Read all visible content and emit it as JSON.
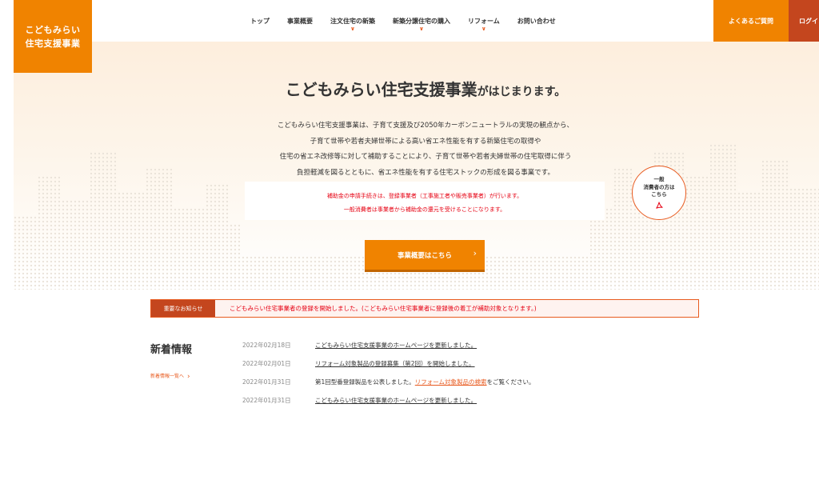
{
  "logo": {
    "line1": "こどもみらい",
    "line2": "住宅支援事業"
  },
  "nav": {
    "items": [
      {
        "label": "トップ",
        "has_dropdown": false
      },
      {
        "label": "事業概要",
        "has_dropdown": false
      },
      {
        "label": "注文住宅の新築",
        "has_dropdown": true
      },
      {
        "label": "新築分譲住宅の購入",
        "has_dropdown": true
      },
      {
        "label": "リフォーム",
        "has_dropdown": true
      },
      {
        "label": "お問い合わせ",
        "has_dropdown": false
      }
    ],
    "dropdown_icon": "chevron-down-icon"
  },
  "header_buttons": {
    "faq": "よくあるご質問",
    "login": "ログイン"
  },
  "hero": {
    "title_main": "こどもみらい住宅支援事業",
    "title_suffix": "がはじまります。",
    "description": [
      "こどもみらい住宅支援事業は、子育て支援及び2050年カーボンニュートラルの実現の観点から、",
      "子育て世帯や若者夫婦世帯による高い省エネ性能を有する新築住宅の取得や",
      "住宅の省エネ改修等に対して補助することにより、子育て世帯や若者夫婦世帯の住宅取得に伴う",
      "負担軽減を図るとともに、省エネ性能を有する住宅ストックの形成を図る事業です。"
    ],
    "notice": [
      "補助金の申請手続きは、登録事業者（工事施工者や販売事業者）が行います。",
      "一般消費者は事業者から補助金の還元を受けることになります。"
    ],
    "consumer_badge": {
      "line1": "一般",
      "line2": "消費者の方は",
      "line3": "こちら",
      "icon": "pdf-icon"
    },
    "overview_button": "事業概要はこちら"
  },
  "alert": {
    "label": "重要なお知らせ",
    "text": "こどもみらい住宅事業者の登録を開始しました。(こどもみらい住宅事業者に登録後の着工が補助対象となります。)"
  },
  "news": {
    "heading": "新着情報",
    "view_all": "新着情報一覧へ",
    "items": [
      {
        "date": "2022年02月18日",
        "text": "こどもみらい住宅支援事業のホームページを更新しました。",
        "link_text": ""
      },
      {
        "date": "2022年02月01日",
        "text": "リフォーム対象製品の登録募集（第2回）を開始しました。",
        "link_text": ""
      },
      {
        "date": "2022年01月31日",
        "text": "第1回型番登録製品を公表しました。",
        "link_text": "リフォーム対象製品の検索",
        "suffix": "をご覧ください。"
      },
      {
        "date": "2022年01月31日",
        "text": "こどもみらい住宅支援事業のホームページを更新しました。",
        "link_text": ""
      }
    ]
  },
  "colors": {
    "brand_orange": "#f08300",
    "brand_red": "#c4461e",
    "alert_red": "#e60012"
  }
}
